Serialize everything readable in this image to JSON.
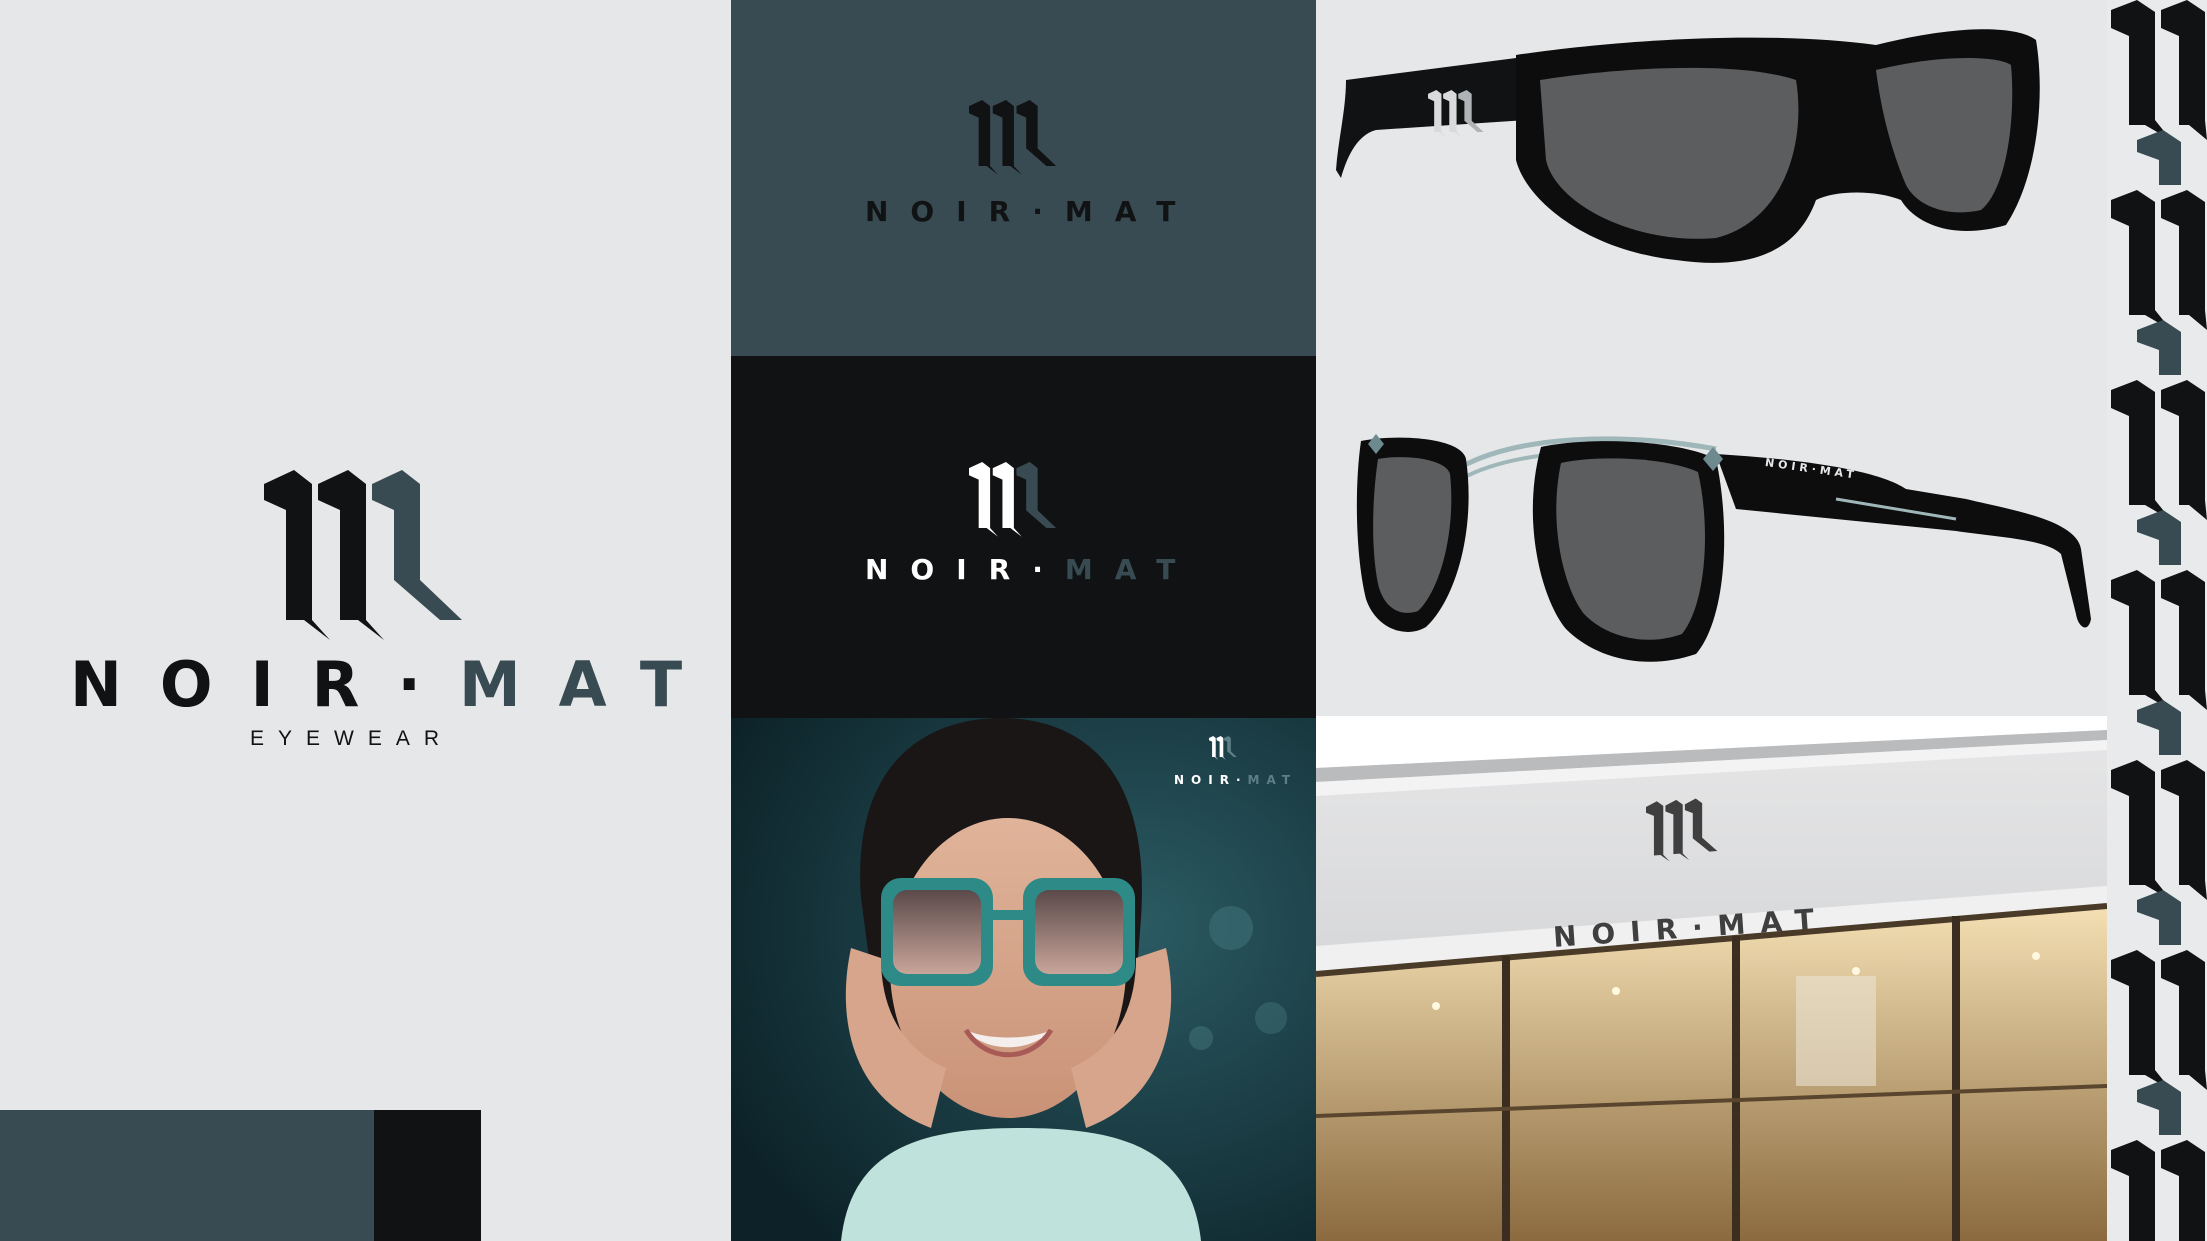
{
  "brand": {
    "name_left": "NOIR",
    "separator": "·",
    "name_right": "MAT",
    "tagline": "EYEWEAR",
    "monogram_icon": "blackletter-m-monogram-icon"
  },
  "palette": {
    "teal": "#394b52",
    "black": "#111213",
    "light_gray": "#e6e7e8",
    "white": "#ffffff"
  },
  "swatches": [
    {
      "name": "teal",
      "color": "#394b52"
    },
    {
      "name": "black",
      "color": "#111213"
    }
  ],
  "frame_temple_text": "NOIR·MAT"
}
